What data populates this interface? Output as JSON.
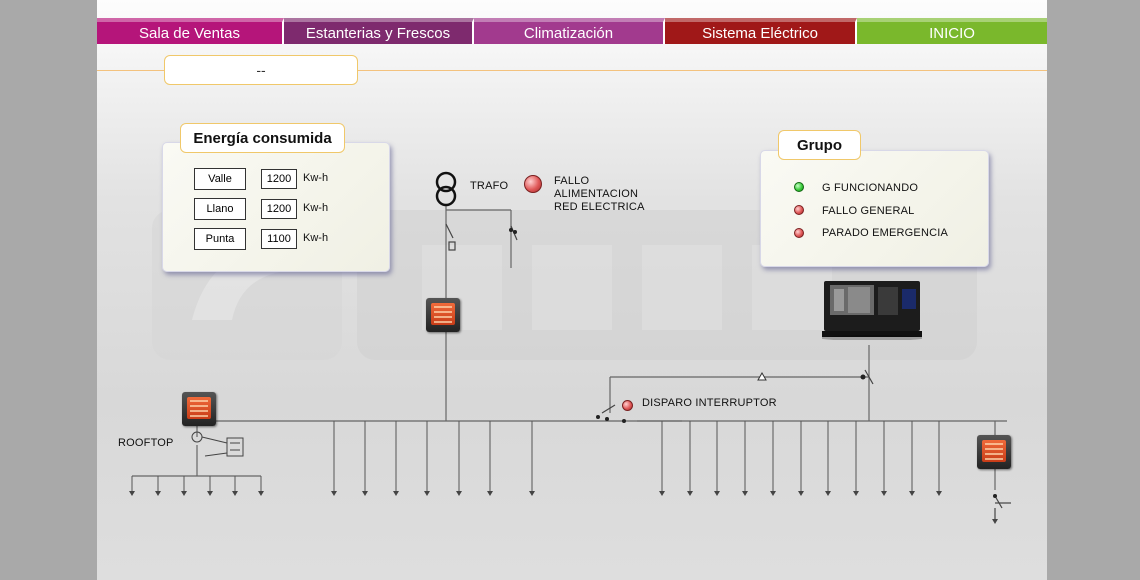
{
  "nav": {
    "items": [
      {
        "label": "Sala de Ventas",
        "color": "#b5157a"
      },
      {
        "label": "Estanterias y Frescos",
        "color": "#7e2a6e"
      },
      {
        "label": "Climatización",
        "color": "#a23a8e"
      },
      {
        "label": "Sistema Eléctrico",
        "color": "#a01818"
      },
      {
        "label": "INICIO",
        "color": "#7ab82c"
      }
    ]
  },
  "status": {
    "text": "--"
  },
  "energy": {
    "title": "Energía consumida",
    "rows": [
      {
        "label": "Valle",
        "value": "1200",
        "unit": "Kw-h"
      },
      {
        "label": "Llano",
        "value": "1200",
        "unit": "Kw-h"
      },
      {
        "label": "Punta",
        "value": "1100",
        "unit": "Kw-h"
      }
    ]
  },
  "grupo": {
    "title": "Grupo",
    "items": [
      {
        "label": "G FUNCIONANDO",
        "led": "green"
      },
      {
        "label": "FALLO GENERAL",
        "led": "red"
      },
      {
        "label": "PARADO EMERGENCIA",
        "led": "red"
      }
    ]
  },
  "diagram": {
    "trafo_label": "TRAFO",
    "fallo_lines": [
      "FALLO",
      "ALIMENTACION",
      "RED ELECTRICA"
    ],
    "disparo_label": "DISPARO INTERRUPTOR",
    "rooftop_label": "ROOFTOP"
  },
  "icons": {
    "transformer": "transformer-icon",
    "meter": "power-meter-icon",
    "generator": "generator-icon",
    "breaker": "breaker-icon"
  }
}
